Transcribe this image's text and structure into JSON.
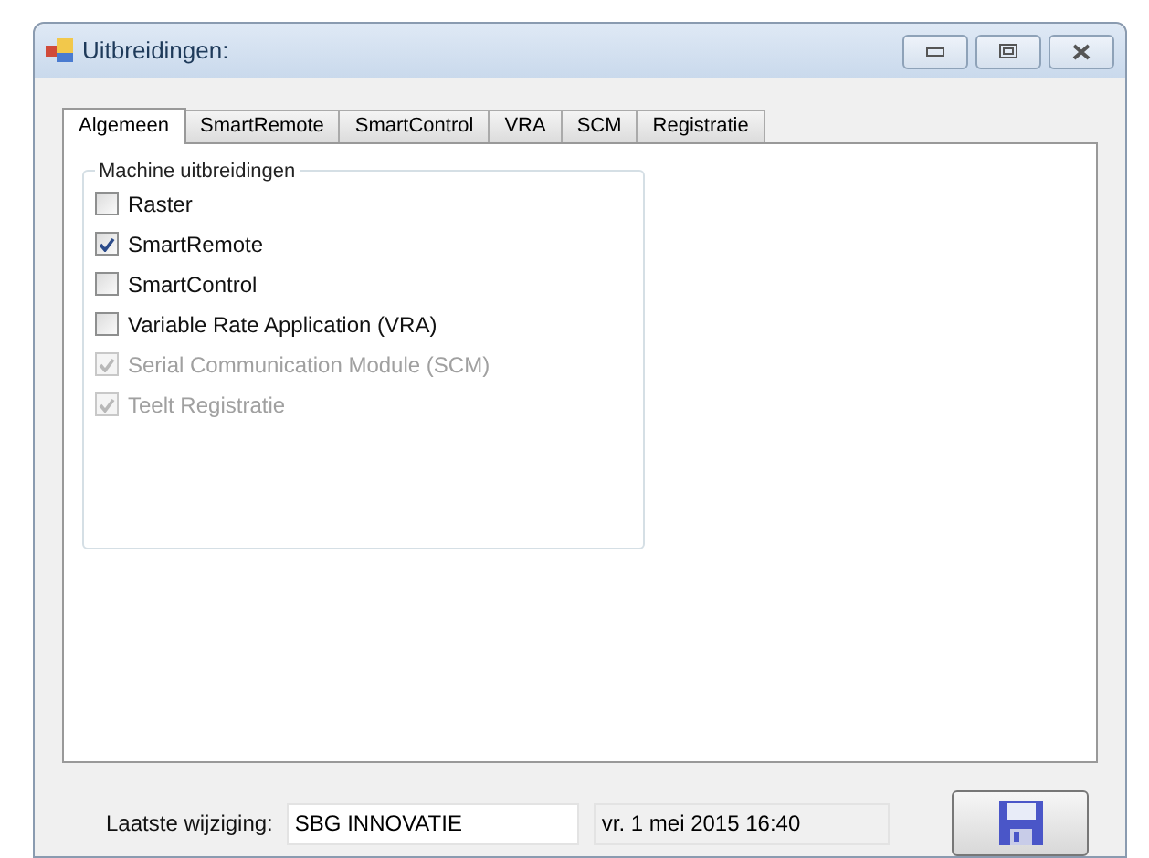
{
  "window": {
    "title": "Uitbreidingen:"
  },
  "tabs": [
    {
      "label": "Algemeen",
      "selected": true
    },
    {
      "label": "SmartRemote",
      "selected": false
    },
    {
      "label": "SmartControl",
      "selected": false
    },
    {
      "label": "VRA",
      "selected": false
    },
    {
      "label": "SCM",
      "selected": false
    },
    {
      "label": "Registratie",
      "selected": false
    }
  ],
  "group": {
    "title": "Machine uitbreidingen",
    "options": [
      {
        "label": "Raster",
        "checked": false,
        "disabled": false
      },
      {
        "label": "SmartRemote",
        "checked": true,
        "disabled": false
      },
      {
        "label": "SmartControl",
        "checked": false,
        "disabled": false
      },
      {
        "label": "Variable Rate Application (VRA)",
        "checked": false,
        "disabled": false
      },
      {
        "label": "Serial Communication Module (SCM)",
        "checked": true,
        "disabled": true
      },
      {
        "label": "Teelt Registratie",
        "checked": true,
        "disabled": true
      }
    ]
  },
  "footer": {
    "label": "Laatste wijziging:",
    "user": "SBG INNOVATIE",
    "date": "vr. 1 mei 2015 16:40"
  }
}
